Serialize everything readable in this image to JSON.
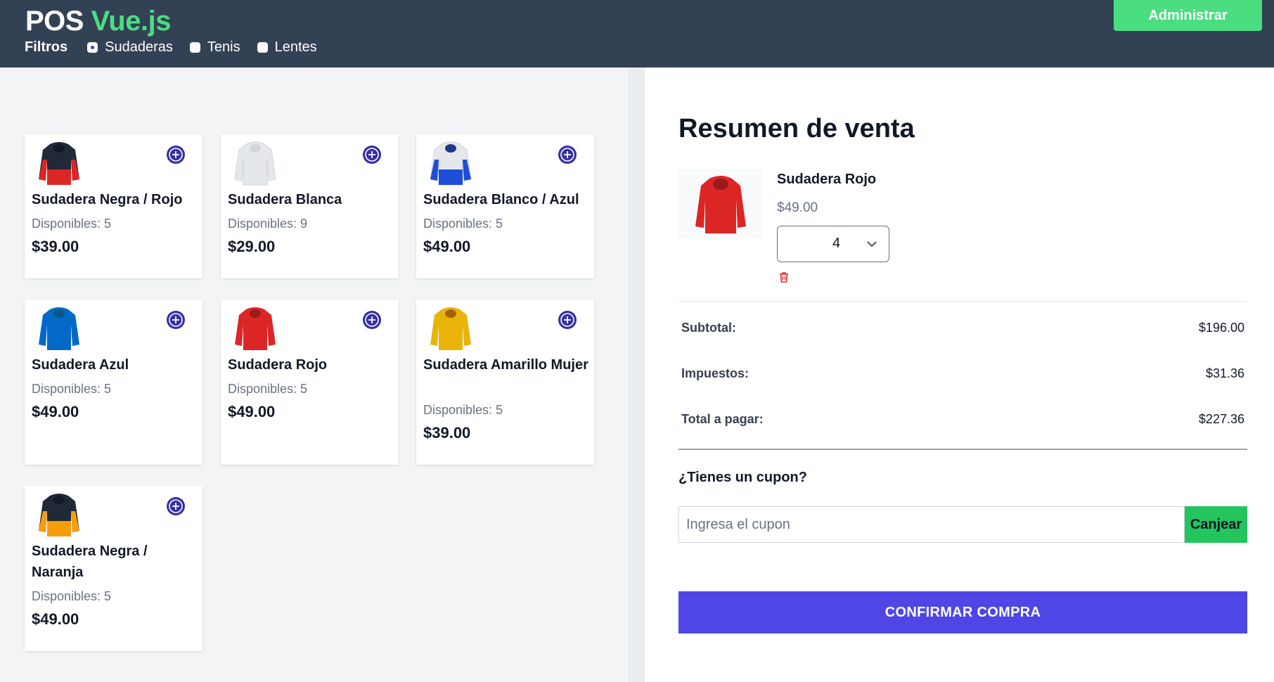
{
  "header": {
    "logo_main": "POS",
    "logo_accent": "Vue.js",
    "filters_label": "Filtros",
    "filters": [
      {
        "label": "Sudaderas",
        "checked": true
      },
      {
        "label": "Tenis",
        "checked": false
      },
      {
        "label": "Lentes",
        "checked": false
      }
    ],
    "admin_label": "Administrar"
  },
  "products": [
    {
      "name": "Sudadera Negra / Rojo",
      "stock": "Disponibles: 5",
      "price": "$39.00",
      "colors": [
        "#1f2937",
        "#dc2626"
      ]
    },
    {
      "name": "Sudadera Blanca",
      "stock": "Disponibles: 9",
      "price": "$29.00",
      "colors": [
        "#e5e7eb",
        "#d1d5db"
      ]
    },
    {
      "name": "Sudadera Blanco / Azul",
      "stock": "Disponibles: 5",
      "price": "$49.00",
      "colors": [
        "#e5e7eb",
        "#1d4ed8"
      ]
    },
    {
      "name": "Sudadera Azul",
      "stock": "Disponibles: 5",
      "price": "$49.00",
      "colors": [
        "#0369c9",
        "#0369c9"
      ]
    },
    {
      "name": "Sudadera Rojo",
      "stock": "Disponibles: 5",
      "price": "$49.00",
      "colors": [
        "#dc2626",
        "#dc2626"
      ]
    },
    {
      "name": "Sudadera Amarillo Mujer",
      "stock": "Disponibles: 5",
      "price": "$39.00",
      "colors": [
        "#eab308",
        "#eab308"
      ]
    },
    {
      "name": "Sudadera Negra / Naranja",
      "stock": "Disponibles: 5",
      "price": "$49.00",
      "colors": [
        "#1f2937",
        "#f59e0b"
      ]
    }
  ],
  "summary": {
    "title": "Resumen de venta",
    "item": {
      "name": "Sudadera Rojo",
      "price": "$49.00",
      "quantity": "4",
      "color": "#dc2626"
    },
    "subtotal_label": "Subtotal:",
    "subtotal": "$196.00",
    "tax_label": "Impuestos:",
    "tax": "$31.36",
    "total_label": "Total a pagar:",
    "total": "$227.36",
    "coupon_question": "¿Tienes un cupon?",
    "coupon_placeholder": "Ingresa el cupon",
    "coupon_button": "Canjear",
    "confirm_button": "CONFIRMAR COMPRA"
  },
  "colors": {
    "header_bg": "#334155",
    "accent_green": "#4ade80",
    "primary": "#4f46e5",
    "add_icon": "#3730a3",
    "trash": "#dc2626"
  }
}
